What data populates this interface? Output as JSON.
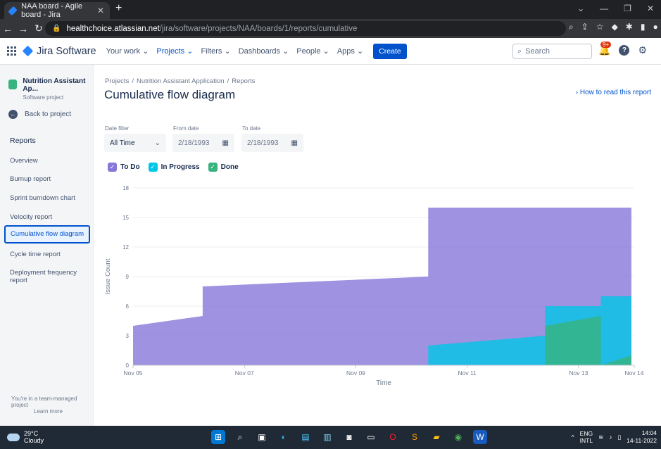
{
  "browser": {
    "tab_title": "NAA board - Agile board - Jira",
    "url_host": "healthchoice.atlassian.net",
    "url_path": "/jira/software/projects/NAA/boards/1/reports/cumulative"
  },
  "jira": {
    "product": "Jira Software",
    "nav": [
      "Your work",
      "Projects",
      "Filters",
      "Dashboards",
      "People",
      "Apps"
    ],
    "create_label": "Create",
    "search_placeholder": "Search",
    "notif_badge": "9+"
  },
  "sidebar": {
    "project_name": "Nutrition Assistant Ap...",
    "project_type": "Software project",
    "back_label": "Back to project",
    "heading": "Reports",
    "items": [
      "Overview",
      "Burnup report",
      "Sprint burndown chart",
      "Velocity report",
      "Cumulative flow diagram",
      "Cycle time report",
      "Deployment frequency report"
    ],
    "active_index": 4,
    "footer_text": "You're in a team-managed project",
    "footer_link": "Learn more"
  },
  "page": {
    "breadcrumbs": [
      "Projects",
      "Nutrition Assistant Application",
      "Reports"
    ],
    "title": "Cumulative flow diagram",
    "how_to": "How to read this report",
    "date_filter_label": "Date filter",
    "date_filter_value": "All Time",
    "from_label": "From date",
    "from_value": "2/18/1993",
    "to_label": "To date",
    "to_value": "2/18/1993"
  },
  "colors": {
    "todo": "#8777d9",
    "inprogress": "#00c7e6",
    "done": "#36b37e",
    "accent": "#0052cc"
  },
  "chart_data": {
    "type": "area",
    "xlabel": "Time",
    "ylabel": "Issue Count",
    "ylim": [
      0,
      18
    ],
    "yticks": [
      0,
      3,
      6,
      9,
      12,
      15,
      18
    ],
    "xlim": [
      0,
      9
    ],
    "xticks": [
      {
        "v": 0,
        "label": "Nov 05"
      },
      {
        "v": 2,
        "label": "Nov 07"
      },
      {
        "v": 4,
        "label": "Nov 09"
      },
      {
        "v": 6,
        "label": "Nov 11"
      },
      {
        "v": 8,
        "label": "Nov 13"
      },
      {
        "v": 9,
        "label": "Nov 14"
      }
    ],
    "series": [
      {
        "name": "To Do",
        "key": "todo",
        "points": [
          [
            0,
            4
          ],
          [
            1.25,
            5
          ],
          [
            1.25,
            8
          ],
          [
            5.3,
            9
          ],
          [
            5.3,
            16
          ],
          [
            8.95,
            16
          ],
          [
            8.95,
            0
          ],
          [
            0,
            0
          ]
        ]
      },
      {
        "name": "In Progress",
        "key": "inprogress",
        "points": [
          [
            5.3,
            0
          ],
          [
            5.3,
            2
          ],
          [
            7.4,
            3
          ],
          [
            7.4,
            6
          ],
          [
            8.4,
            6
          ],
          [
            8.4,
            7
          ],
          [
            8.95,
            7
          ],
          [
            8.95,
            0
          ]
        ]
      },
      {
        "name": "Done",
        "key": "done",
        "points": [
          [
            7.4,
            0
          ],
          [
            7.4,
            4
          ],
          [
            8.4,
            5
          ],
          [
            8.4,
            0
          ],
          [
            8.95,
            1
          ],
          [
            8.95,
            0
          ]
        ]
      }
    ]
  },
  "taskbar": {
    "temp": "29°C",
    "condition": "Cloudy",
    "lang1": "ENG",
    "lang2": "INTL",
    "time": "14:04",
    "date": "14-11-2022"
  }
}
